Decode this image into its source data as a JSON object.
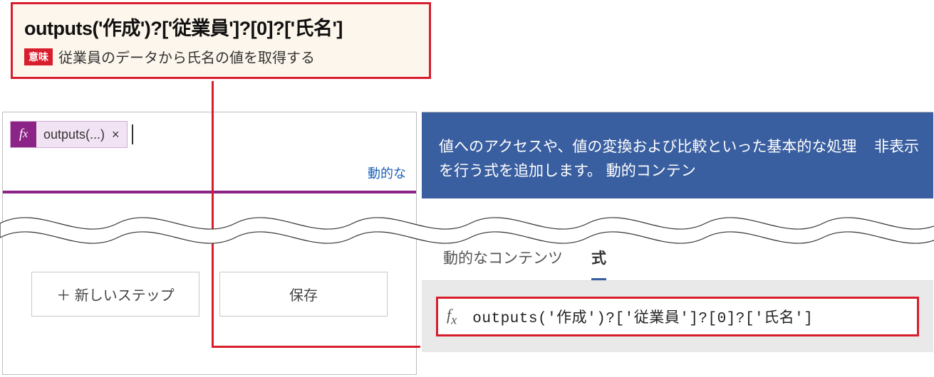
{
  "callout": {
    "expression": "outputs('作成')?['従業員']?[0]?['氏名']",
    "meaning_badge": "意味",
    "meaning_text": "従業員のデータから氏名の値を取得する"
  },
  "editor": {
    "token_label": "outputs(...)",
    "dynamic_link_partial": "動的な",
    "new_step_label": "＋ 新しいステップ",
    "save_label": "保存"
  },
  "panel": {
    "help_text": "値へのアクセスや、値の変換および比較といった基本的な処理を行う式を追加します。 動的コンテン",
    "hide_label": "非表示",
    "tab_dynamic": "動的なコンテンツ",
    "tab_expression": "式",
    "expression_value": "outputs('作成')?['従業員']?[0]?['氏名']"
  }
}
